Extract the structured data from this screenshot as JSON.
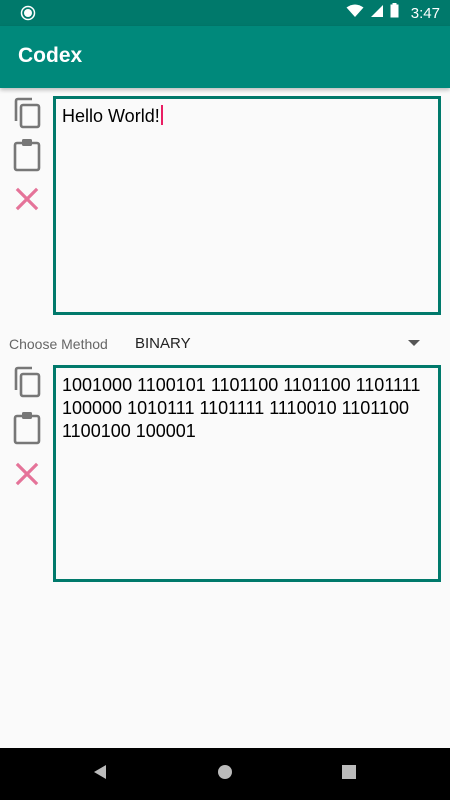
{
  "status_bar": {
    "time": "3:47",
    "icons": [
      "notification-dot-icon",
      "wifi-icon",
      "signal-icon",
      "battery-icon"
    ]
  },
  "app_bar": {
    "title": "Codex",
    "color": "#00897b"
  },
  "input": {
    "value": "Hello World!",
    "actions": [
      "copy-icon",
      "paste-icon",
      "clear-icon"
    ]
  },
  "method": {
    "label": "Choose Method",
    "selected": "BINARY"
  },
  "output": {
    "value": "1001000 1100101 1101100 1101100 1101111 100000 1010111 1101111 1110010 1101100 1100100 100001",
    "actions": [
      "copy-icon",
      "paste-icon",
      "clear-icon"
    ]
  },
  "nav_bar": {
    "buttons": [
      "back-icon",
      "home-icon",
      "recents-icon"
    ]
  },
  "colors": {
    "primary": "#00897b",
    "primary_dark": "#00796b",
    "accent": "#e91e63",
    "clear": "#e57399"
  }
}
